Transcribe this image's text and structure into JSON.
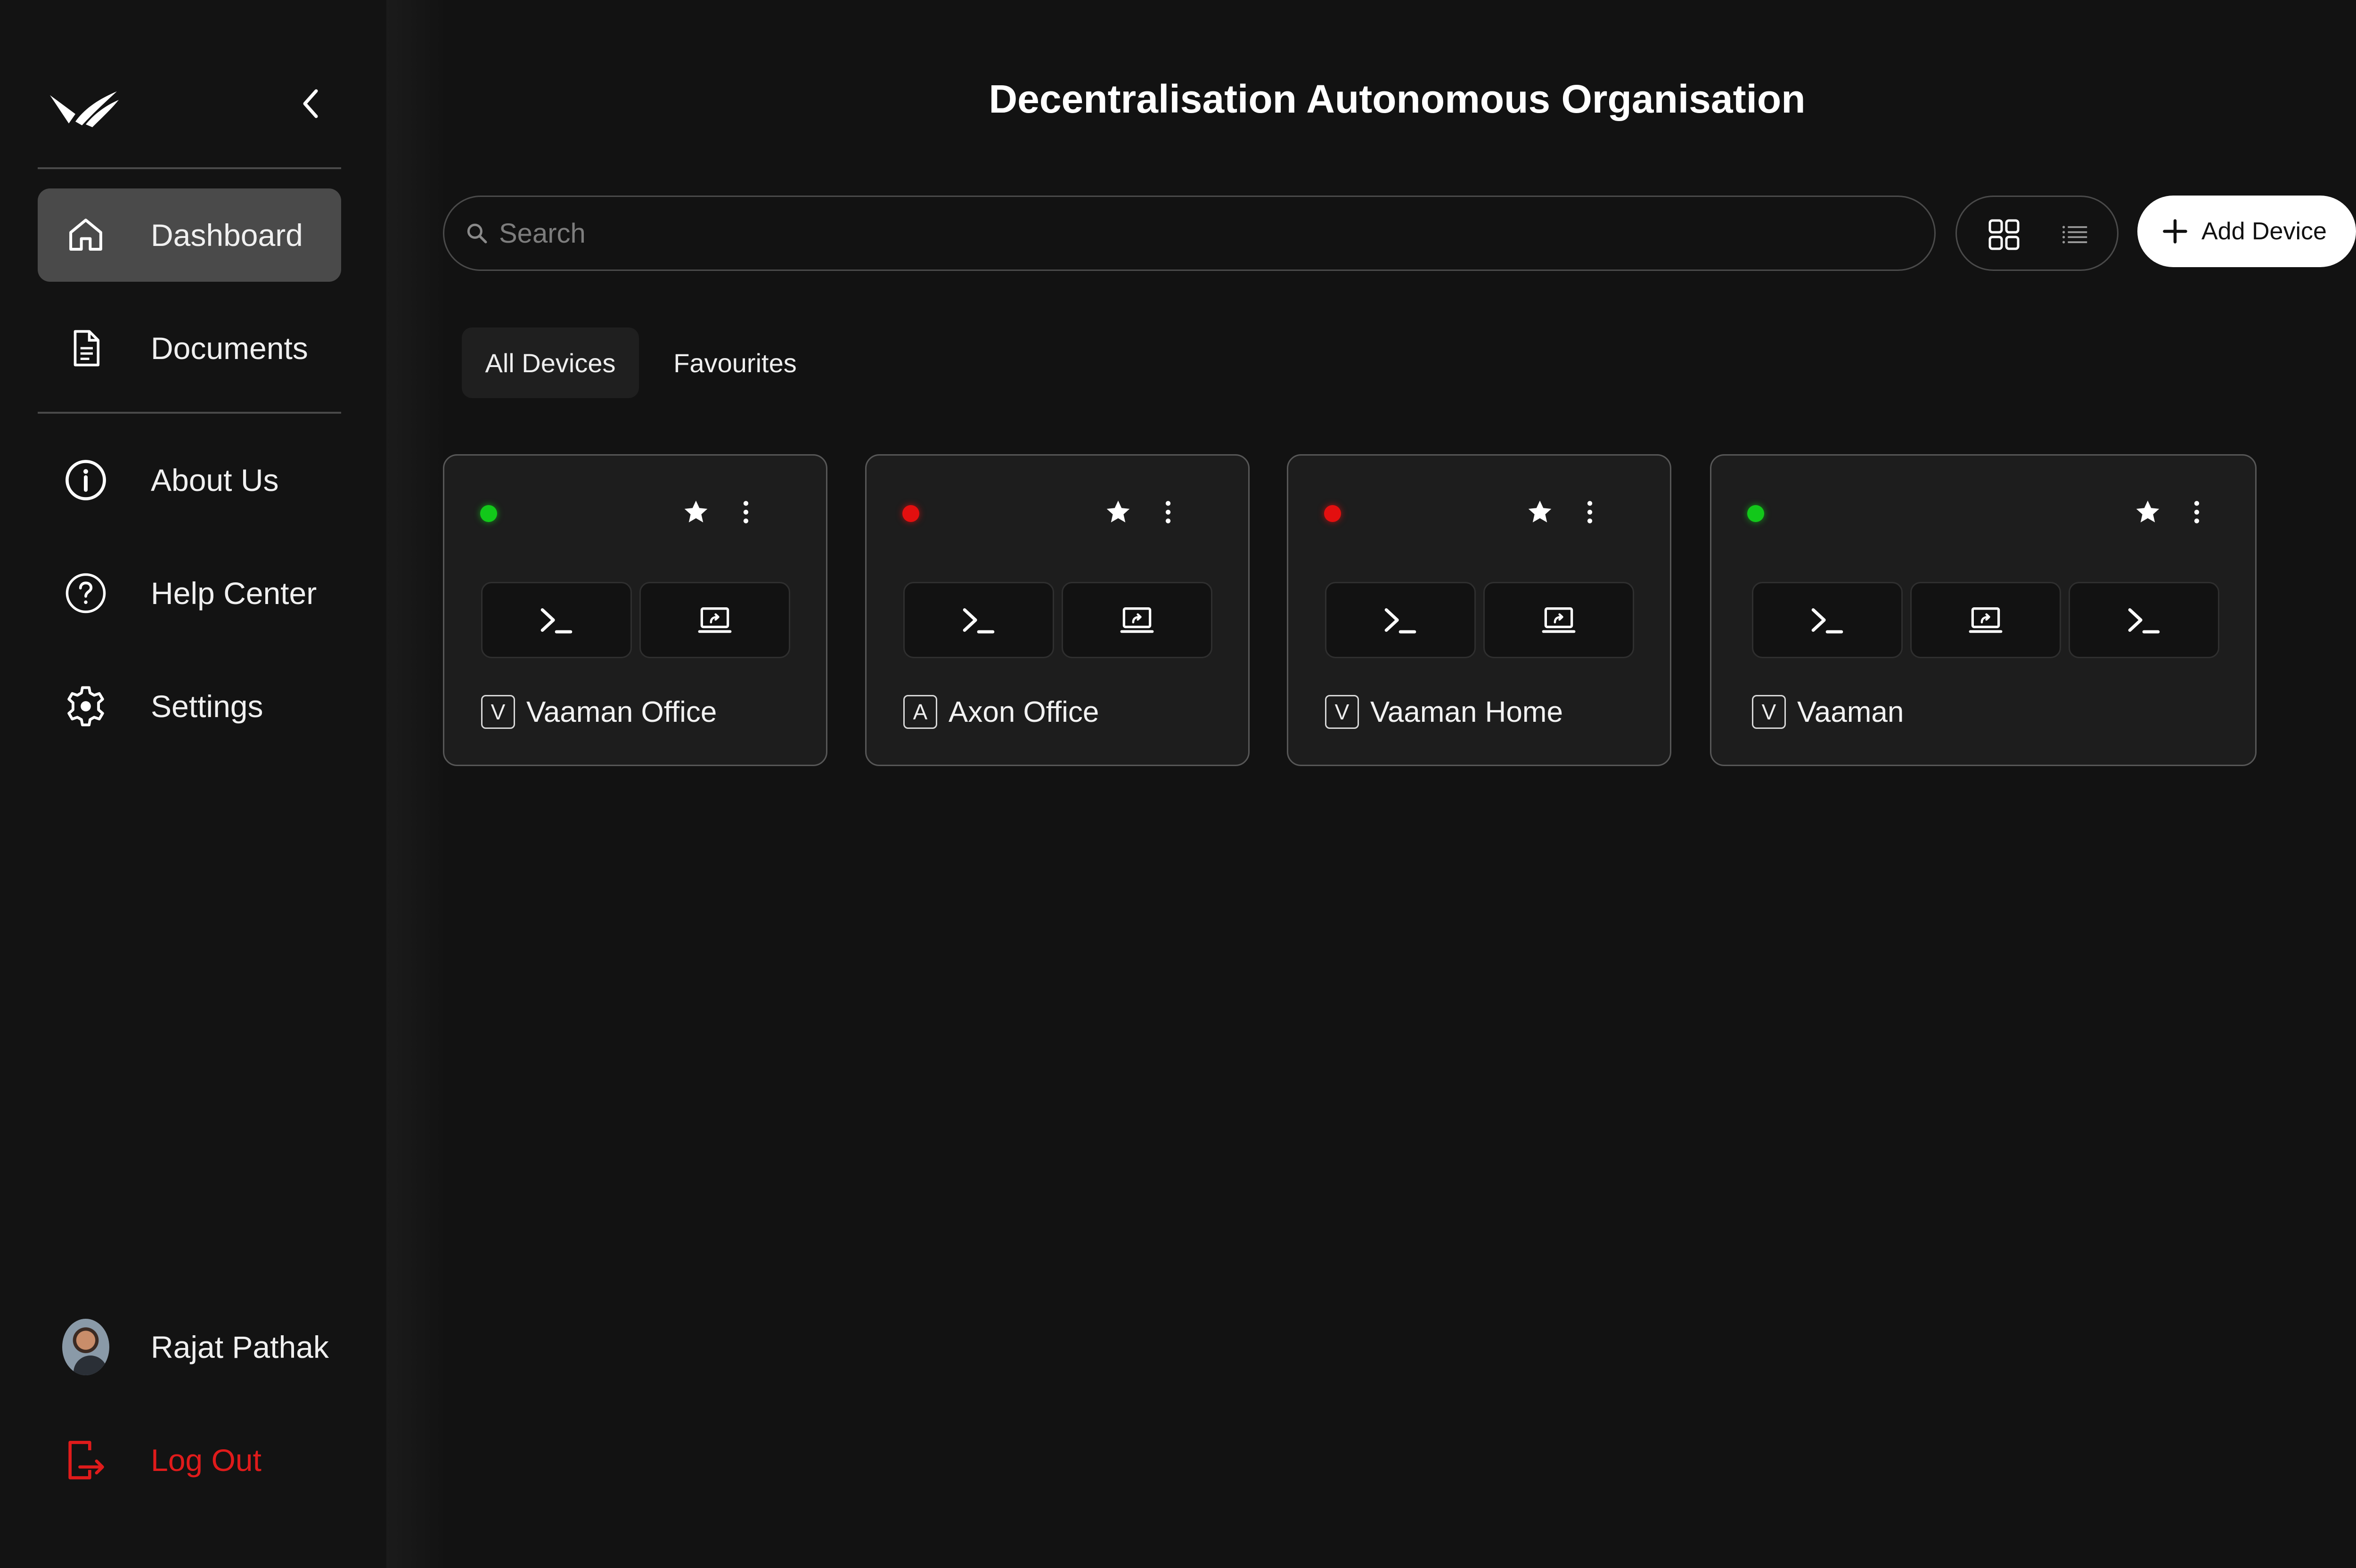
{
  "app": {
    "title": "Decentralisation Autonomous Organisation"
  },
  "sidebar": {
    "nav": [
      {
        "label": "Dashboard",
        "icon": "home-icon",
        "active": true
      },
      {
        "label": "Documents",
        "icon": "document-icon",
        "active": false
      }
    ],
    "secondary": [
      {
        "label": "About Us",
        "icon": "info-icon"
      },
      {
        "label": "Help Center",
        "icon": "help-icon"
      },
      {
        "label": "Settings",
        "icon": "gear-icon"
      }
    ],
    "user": {
      "name": "Rajat Pathak"
    },
    "logout": {
      "label": "Log Out",
      "icon": "logout-icon"
    }
  },
  "toolbar": {
    "search_placeholder": "Search",
    "search_value": "",
    "add_device_label": "Add Device"
  },
  "tabs": [
    {
      "label": "All Devices",
      "active": true
    },
    {
      "label": "Favourites",
      "active": false
    }
  ],
  "devices": [
    {
      "name": "Vaaman Office",
      "badge": "V",
      "status": "online",
      "favourite": true,
      "actions": [
        "terminal",
        "remote-desktop"
      ]
    },
    {
      "name": "Axon Office",
      "badge": "A",
      "status": "offline",
      "favourite": true,
      "actions": [
        "terminal",
        "remote-desktop"
      ]
    },
    {
      "name": "Vaaman Home",
      "badge": "V",
      "status": "offline",
      "favourite": true,
      "actions": [
        "terminal",
        "remote-desktop"
      ]
    },
    {
      "name": "Vaaman",
      "badge": "V",
      "status": "online",
      "favourite": true,
      "actions": [
        "terminal",
        "remote-desktop",
        "terminal"
      ]
    }
  ],
  "colors": {
    "background": "#121212",
    "online": "#12c81a",
    "offline": "#e30f0f",
    "logout": "#e01b1b",
    "accent_button": "#ffffff"
  }
}
